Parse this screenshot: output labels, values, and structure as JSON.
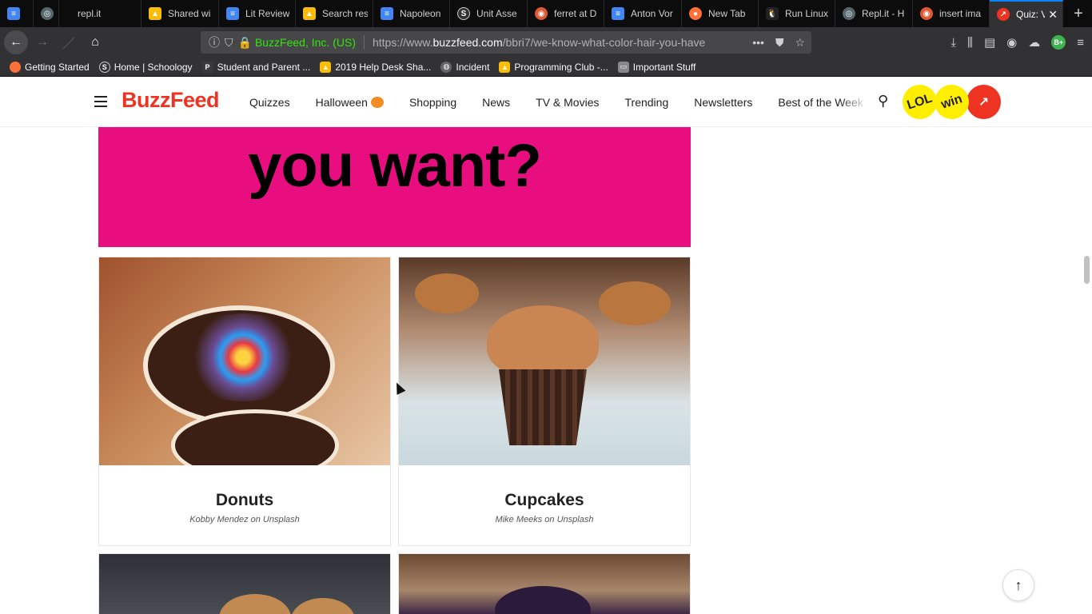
{
  "browser": {
    "tabs": [
      {
        "label": "",
        "icon": "google-docs-icon",
        "color": "#4285f4"
      },
      {
        "label": "",
        "icon": "replit-icon",
        "color": "#56676e"
      },
      {
        "label": "repl.it",
        "icon": "",
        "color": ""
      },
      {
        "label": "Shared wi",
        "icon": "google-drive-icon",
        "color": "#fbbc04"
      },
      {
        "label": "Lit Review",
        "icon": "google-docs-icon",
        "color": "#4285f4"
      },
      {
        "label": "Search res",
        "icon": "google-drive-icon",
        "color": "#fbbc04"
      },
      {
        "label": "Napoleon",
        "icon": "google-docs-icon",
        "color": "#4285f4"
      },
      {
        "label": "Unit Asse",
        "icon": "schoology-icon",
        "color": "#333333"
      },
      {
        "label": "ferret at D",
        "icon": "duckduckgo-icon",
        "color": "#de5833"
      },
      {
        "label": "Anton Vor",
        "icon": "google-docs-icon",
        "color": "#4285f4"
      },
      {
        "label": "New Tab",
        "icon": "firefox-icon",
        "color": "#ff7139"
      },
      {
        "label": "Run Linux",
        "icon": "linux-icon",
        "color": "#222222"
      },
      {
        "label": "Repl.it - H",
        "icon": "replit-icon",
        "color": "#56676e"
      },
      {
        "label": "insert ima",
        "icon": "duckduckgo-icon",
        "color": "#de5833"
      },
      {
        "label": "Quiz: V",
        "icon": "buzzfeed-icon",
        "color": "#ee3322"
      }
    ],
    "url_identity": "BuzzFeed, Inc. (US)",
    "url_prefix": "https://www.",
    "url_domain": "buzzfeed.com",
    "url_path": "/bbri7/we-know-what-color-hair-you-have",
    "bookmarks": [
      {
        "label": "Getting Started",
        "icon": "firefox-icon",
        "color": "#ff7139"
      },
      {
        "label": "Home | Schoology",
        "icon": "schoology-icon",
        "color": "#333333"
      },
      {
        "label": "Student and Parent ...",
        "icon": "powerschool-icon",
        "color": "#3a3a3a"
      },
      {
        "label": "2019 Help Desk Sha...",
        "icon": "google-drive-icon",
        "color": "#fbbc04"
      },
      {
        "label": "Incident",
        "icon": "globe-icon",
        "color": "#666666"
      },
      {
        "label": "Programming Club -...",
        "icon": "google-drive-icon",
        "color": "#fbbc04"
      },
      {
        "label": "Important Stuff",
        "icon": "folder-icon",
        "color": "#888888"
      }
    ],
    "profile_badge": "B+"
  },
  "site": {
    "logo": "BuzzFeed",
    "nav": [
      "Quizzes",
      "Halloween",
      "Shopping",
      "News",
      "TV & Movies",
      "Trending",
      "Newsletters",
      "Best of the Week"
    ],
    "badges": [
      "LOL",
      "win"
    ]
  },
  "hero": {
    "text": "you want?",
    "background": "#e90e7f"
  },
  "answers": [
    {
      "title": "Donuts",
      "credit": "Kobby Mendez on Unsplash"
    },
    {
      "title": "Cupcakes",
      "credit": "Mike Meeks on Unsplash"
    }
  ]
}
